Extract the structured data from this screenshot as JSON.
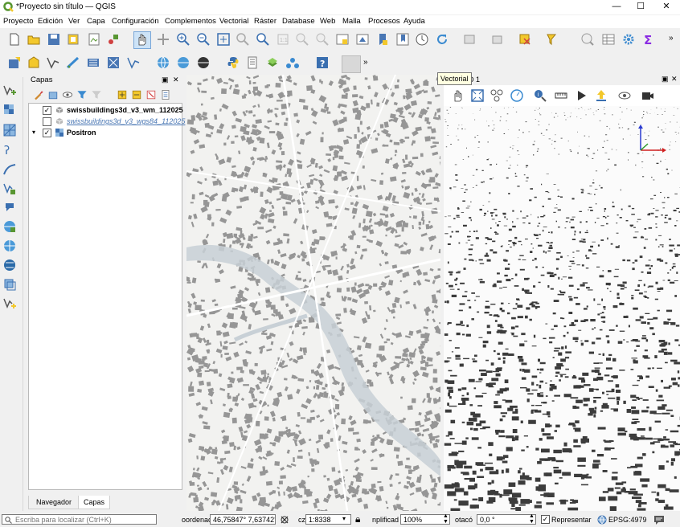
{
  "window": {
    "title": "*Proyecto sin título — QGIS",
    "controls": {
      "minimize": "—",
      "maximize": "☐",
      "close": "✕"
    }
  },
  "menu": [
    "Proyecto",
    "Edición",
    "Ver",
    "Capa",
    "Configuración",
    "Complementos",
    "Vectorial",
    "Ráster",
    "Database",
    "Web",
    "Malla",
    "Procesos",
    "Ayuda"
  ],
  "toolbar_overflow": "»",
  "tooltip": "Vectorial",
  "layers_panel": {
    "title": "Capas",
    "layers": [
      {
        "name": "swissbuildings3d_v3_wm_112025",
        "checked": true
      },
      {
        "name": "swissbuildings3d_v3_wgs84_112025",
        "checked": false
      },
      {
        "name": "Positron",
        "checked": true
      }
    ],
    "check_mark": "✓",
    "tabs": [
      "Navegador",
      "Capas"
    ],
    "float_button": "▣",
    "close_button": "✕"
  },
  "view3d": {
    "title": "3D 1",
    "float_button": "▣",
    "close_button": "✕"
  },
  "status": {
    "search_placeholder": "Escriba para localizar (Ctrl+K)",
    "coord_label": "oordenac",
    "coord_value": "46,75847°  7,63742°",
    "scale_label": "cz",
    "scale_value": "1:8338",
    "magnifier_label": "nplificad",
    "magnifier_value": "100%",
    "rotation_label": "otacó",
    "rotation_value": "0,0 °",
    "render_label": "Representar",
    "crs": "EPSG:4979"
  },
  "colors": {
    "accent_green": "#589632",
    "qgis_yellow": "#f3c82c",
    "building_2d": "#8c8c8c",
    "building_3d": "#3c3c3c",
    "river": "#c8d0d6"
  },
  "icons": {
    "top_toolbar_1": [
      "new-project-icon",
      "open-project-icon",
      "save-project-icon",
      "save-as-icon",
      "print-layout-icon",
      "style-manager-icon",
      "pan-icon",
      "pan-to-selection-icon",
      "zoom-in-icon",
      "zoom-out-icon",
      "zoom-full-icon",
      "zoom-to-selection-icon",
      "zoom-to-layer-icon",
      "zoom-native-icon",
      "zoom-last-icon",
      "zoom-next-icon",
      "new-map-view-icon",
      "new-3d-view-icon",
      "temporal-controller-icon",
      "refresh-icon",
      "select-feature-icon",
      "deselect-icon",
      "select-by-location-icon",
      "select-by-expression-icon",
      "identify-icon",
      "attribute-table-icon",
      "settings-icon",
      "sum-icon"
    ],
    "top_toolbar_2": [
      "digitize-icon",
      "save-edits-icon",
      "vertex-tool-icon",
      "add-line-icon",
      "add-polygon-icon",
      "move-feature-icon",
      "node-tool-icon",
      "wms-icon",
      "wcs-icon",
      "wfs-icon",
      "python-icon",
      "script-icon",
      "plugin-icon",
      "network-icon",
      "help-icon"
    ],
    "left_toolbar": [
      "add-vector-layer-icon",
      "add-raster-layer-icon",
      "add-mesh-layer-icon",
      "add-delimited-text-icon",
      "add-gps-layer-icon",
      "add-spatialite-icon",
      "add-postgis-icon",
      "add-wms-icon",
      "add-wfs-icon",
      "add-wcs-icon",
      "add-virtual-layer-icon",
      "new-vector-layer-icon"
    ],
    "layers_toolbar": [
      "open-styling-icon",
      "add-group-icon",
      "manage-visibility-icon",
      "filter-legend-icon",
      "filter-by-expression-icon",
      "expand-all-icon",
      "collapse-all-icon",
      "remove-layer-icon",
      "properties-icon"
    ],
    "toolbar_3d": [
      "pan-3d-icon",
      "zoom-full-3d-icon",
      "identify-3d-icon",
      "measure-3d-icon",
      "animations-icon",
      "export-icon",
      "camera-icon",
      "view-menu-icon",
      "settings-3d-icon"
    ]
  }
}
